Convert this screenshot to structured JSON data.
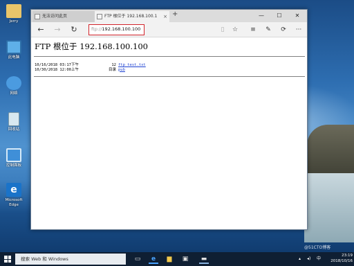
{
  "desktop": {
    "icons": [
      {
        "label": "Jerry",
        "icon": "user-folder-icon",
        "color": "#e9c56a"
      },
      {
        "label": "此电脑",
        "icon": "computer-icon",
        "color": "#5fb0e8"
      },
      {
        "label": "网络",
        "icon": "network-icon",
        "color": "#4b9be0"
      },
      {
        "label": "回收站",
        "icon": "recycle-bin-icon",
        "color": "#d8e8f0"
      },
      {
        "label": "控制面板",
        "icon": "control-panel-icon",
        "color": "#3f8fd8"
      },
      {
        "label": "Microsoft Edge",
        "icon": "edge-icon",
        "color": "#1a73c9"
      }
    ]
  },
  "browser": {
    "tabs": [
      {
        "label": "无法访问此页",
        "active": false
      },
      {
        "label": "FTP 根位于 192.168.100.1",
        "active": true
      }
    ],
    "new_tab": "+",
    "window_controls": {
      "minimize": "—",
      "maximize": "☐",
      "close": "✕"
    },
    "nav": {
      "back": "←",
      "forward": "→",
      "refresh": "↻"
    },
    "address": {
      "protocol": "ftp://",
      "host": "192.168.100.100"
    },
    "tools": {
      "reading_view": "▯",
      "favorite": "☆",
      "hub": "≡",
      "note": "✎",
      "share": "⟳",
      "more": "···"
    }
  },
  "page": {
    "title": "FTP 根位于 192.168.100.100",
    "entries": [
      {
        "date": "10/16/2018 03:17下午",
        "size": "12",
        "name": "ftp_test.txt"
      },
      {
        "date": "10/30/2018 12:00上午",
        "size": "目录",
        "name": "pub"
      }
    ]
  },
  "taskbar": {
    "search_placeholder": "搜索 Web 和 Windows",
    "time": "23:19",
    "date": "2018/10/16",
    "tray_lang": "中",
    "watermark": "@51CTO博客"
  },
  "colors": {
    "address_highlight": "#d2232a",
    "link": "#1a3fd1",
    "taskbar": "#0f1f33"
  }
}
